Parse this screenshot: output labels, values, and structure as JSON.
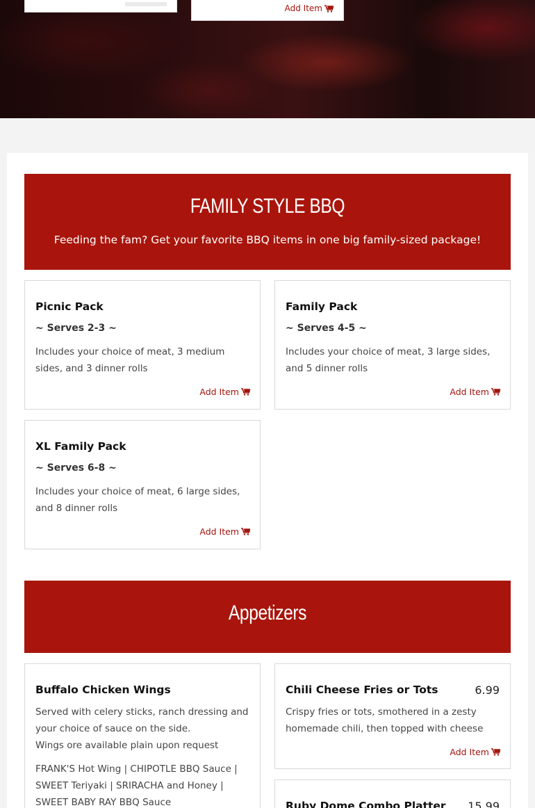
{
  "hero": {
    "card1_add": "",
    "card2_add": "Add Item"
  },
  "family": {
    "heading": "FAMILY STYLE BBQ",
    "subheading": "Feeding the fam? Get your favorite BBQ items in one big family-sized package!",
    "items": [
      {
        "title": "Picnic Pack",
        "serves": "~ Serves 2-3 ~",
        "desc": "Includes your choice of meat, 3 medium sides, and 3 dinner rolls",
        "add": "Add Item"
      },
      {
        "title": "Family Pack",
        "serves": "~ Serves 4-5 ~",
        "desc": "Includes your choice of meat, 3 large sides, and 5 dinner rolls",
        "add": "Add Item"
      },
      {
        "title": "XL Family Pack",
        "serves": "~ Serves 6-8 ~",
        "desc": "Includes your choice of meat, 6 large sides, and 8 dinner rolls",
        "add": "Add Item"
      }
    ]
  },
  "appetizers": {
    "heading": "Appetizers",
    "items": [
      {
        "title": "Buffalo Chicken Wings",
        "desc": "Served with celery sticks, ranch dressing and your choice of sauce on the side.",
        "note": "Wings ore available plain upon request",
        "sauces": "FRANK'S Hot Wing | CHIPOTLE BBQ Sauce | SWEET Teriyaki | SRIRACHA and Honey | SWEET BABY RAY BBQ Sauce"
      },
      {
        "title": "Chili Cheese Fries or Tots",
        "price": "6.99",
        "desc": "Crispy fries or tots, smothered in a zesty homemade chili, then topped with cheese",
        "add": "Add Item"
      },
      {
        "title": "Ruby Dome Combo Platter",
        "price": "15.99"
      }
    ]
  },
  "icons": {
    "cart": "shopping-cart-icon"
  },
  "colors": {
    "accent": "#a9150c",
    "link": "#a3140d"
  }
}
